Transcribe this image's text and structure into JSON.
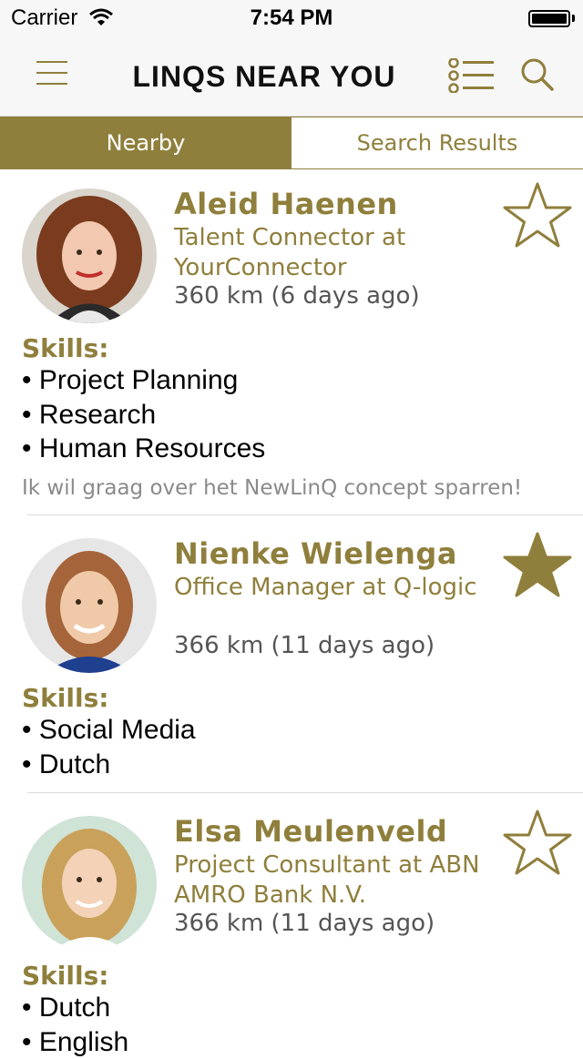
{
  "status_bar": {
    "carrier": "Carrier",
    "time": "7:54 PM"
  },
  "nav": {
    "title": "LINQS NEAR YOU",
    "menu_icon": "hamburger-menu-icon",
    "list_icon": "list-icon",
    "search_icon": "search-icon"
  },
  "tabs": [
    {
      "label": "Nearby",
      "active": true
    },
    {
      "label": "Search Results",
      "active": false
    }
  ],
  "people": [
    {
      "name": "Aleid Haenen",
      "role": "Talent Connector at YourConnector",
      "distance": "360 km (6 days ago)",
      "favorite": false,
      "skills_heading": "Skills:",
      "skills": [
        "Project Planning",
        "Research",
        "Human Resources"
      ],
      "message": "Ik wil graag over het NewLinQ concept sparren!"
    },
    {
      "name": "Nienke Wielenga",
      "role": "Office Manager at Q-logic",
      "distance": "366 km (11 days ago)",
      "favorite": true,
      "skills_heading": "Skills:",
      "skills": [
        "Social Media",
        "Dutch"
      ],
      "message": ""
    },
    {
      "name": "Elsa Meulenveld",
      "role": "Project Consultant at ABN AMRO Bank N.V.",
      "distance": "366 km (11 days ago)",
      "favorite": false,
      "skills_heading": "Skills:",
      "skills": [
        "Dutch",
        "English"
      ],
      "message": ""
    }
  ],
  "colors": {
    "accent": "#8f7f3c",
    "text": "#000000",
    "muted": "#8a8a8a"
  }
}
